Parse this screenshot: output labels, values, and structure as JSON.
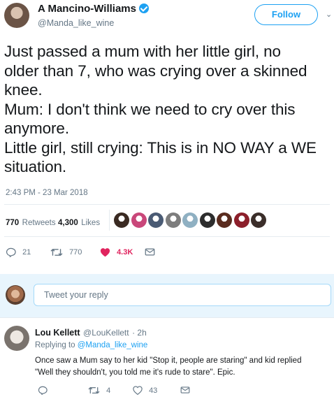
{
  "tweet": {
    "author_name": "A Mancino-Williams",
    "author_handle": "@Manda_like_wine",
    "follow_label": "Follow",
    "caret": "⌄",
    "lines": [
      "Just passed a mum with her little girl, no",
      "older than 7, who was crying over a skinned",
      "knee.",
      "Mum: I don't think we need to cry over this",
      "anymore.",
      "Little girl, still crying: This is in NO WAY a WE",
      "situation."
    ],
    "timestamp": "2:43 PM - 23 Mar 2018",
    "retweets_count": "770",
    "retweets_label": "Retweets",
    "likes_count": "4,300",
    "likes_label": "Likes",
    "actions": {
      "reply_count": "21",
      "retweet_count": "770",
      "like_count": "4.3K"
    },
    "liker_colors": [
      "#3a2a22",
      "#c9477a",
      "#4a5b74",
      "#7d7d7d",
      "#8fb0c2",
      "#2d2d2d",
      "#5a2c1f",
      "#8c1f2b",
      "#3b2e2a"
    ],
    "accent": "#1da1f2",
    "like_color": "#e0245e"
  },
  "reply_box": {
    "placeholder": "Tweet your reply"
  },
  "reply": {
    "author_name": "Lou Kellett",
    "author_handle": "@LouKellett",
    "time": "· 2h",
    "replying_prefix": "Replying to",
    "replying_handle": "@Manda_like_wine",
    "lines": [
      "Once saw a Mum say to her kid \"Stop it, people are staring\" and kid replied",
      "\"Well they shouldn't, you told me it's rude to stare\".  Epic."
    ],
    "actions": {
      "retweet_count": "4",
      "like_count": "43"
    }
  }
}
